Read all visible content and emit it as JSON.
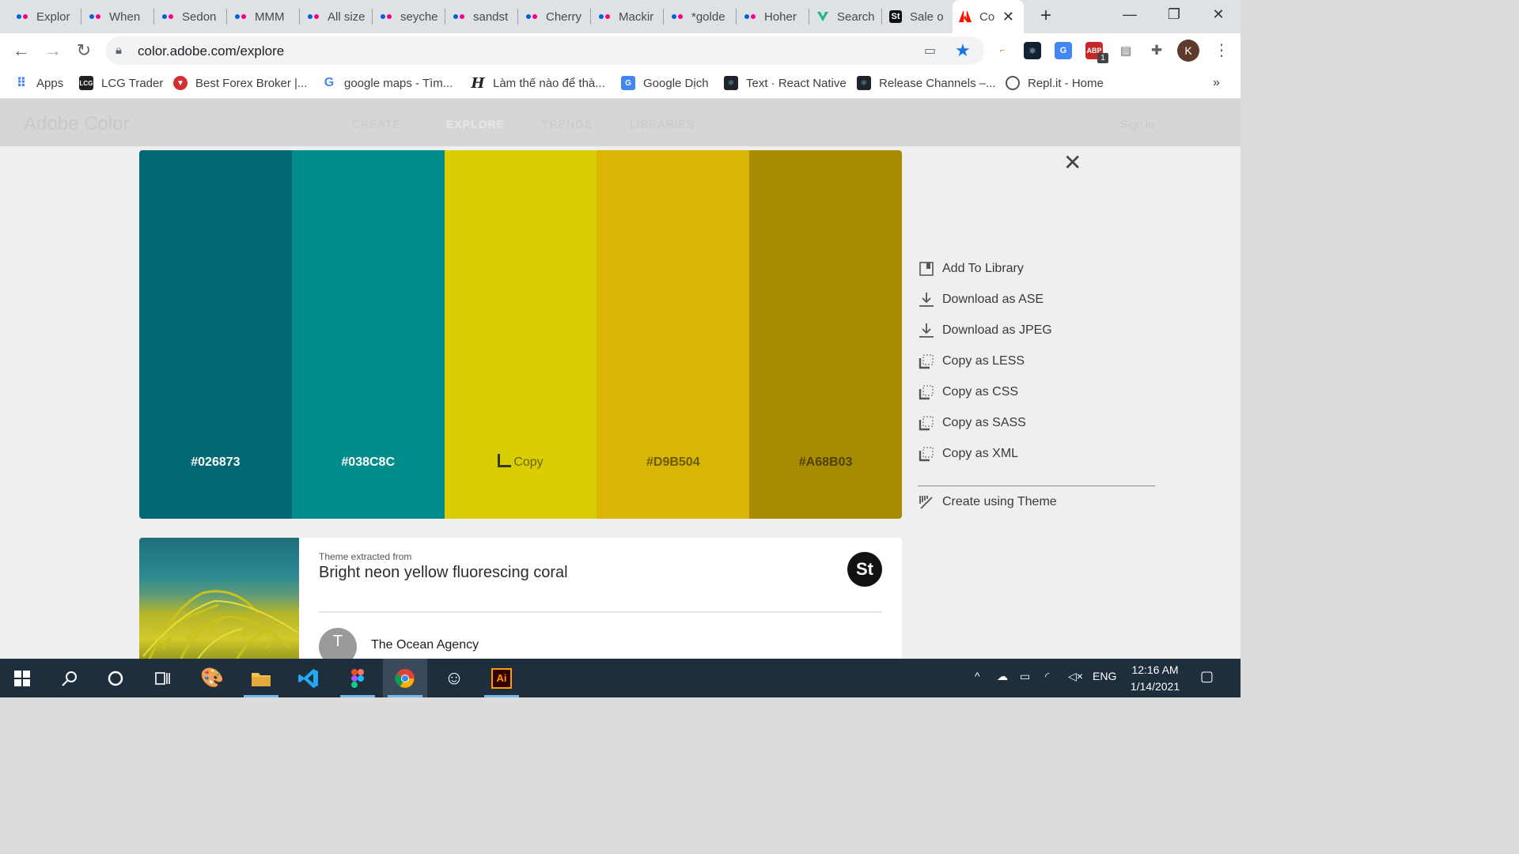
{
  "tabs": [
    {
      "title": "Explor",
      "icon": "flickr-icon"
    },
    {
      "title": "When",
      "icon": "flickr-icon"
    },
    {
      "title": "Sedon",
      "icon": "flickr-icon"
    },
    {
      "title": "MMM",
      "icon": "flickr-icon"
    },
    {
      "title": "All size",
      "icon": "flickr-icon"
    },
    {
      "title": "seyche",
      "icon": "flickr-icon"
    },
    {
      "title": "sandst",
      "icon": "flickr-icon"
    },
    {
      "title": "Cherry",
      "icon": "flickr-icon"
    },
    {
      "title": "Mackir",
      "icon": "flickr-icon"
    },
    {
      "title": "*golde",
      "icon": "flickr-icon"
    },
    {
      "title": "Hoher",
      "icon": "flickr-icon"
    },
    {
      "title": "Search",
      "icon": "vuetify-icon"
    },
    {
      "title": "Sale o",
      "icon": "stock-icon"
    },
    {
      "title": "Co",
      "icon": "adobe-icon",
      "active": true
    }
  ],
  "toolbar": {
    "url": "color.adobe.com/explore",
    "profile_initial": "K",
    "ext_badge": "1"
  },
  "bookmarks": [
    {
      "label": "Apps",
      "icon": "apps-grid-icon"
    },
    {
      "label": "LCG Trader",
      "icon": "lcg-icon"
    },
    {
      "label": "Best Forex Broker |...",
      "icon": "forex-icon"
    },
    {
      "label": "google maps - Tìm...",
      "icon": "google-icon"
    },
    {
      "label": "Làm thế nào để thà...",
      "icon": "script-h-icon"
    },
    {
      "label": "Google Dịch",
      "icon": "google-translate-icon"
    },
    {
      "label": "Text · React Native",
      "icon": "react-icon"
    },
    {
      "label": "Release Channels –...",
      "icon": "react-icon"
    },
    {
      "label": "Repl.it - Home",
      "icon": "replit-icon"
    }
  ],
  "adobe_header": {
    "brand": "Adobe Color",
    "nav": [
      "CREATE",
      "EXPLORE",
      "TRENDS",
      "LIBRARIES"
    ],
    "sign_in": "Sign in"
  },
  "palette": {
    "swatches": [
      {
        "hex": "#026873",
        "label": "#026873",
        "text_color": "#ffffff"
      },
      {
        "hex": "#038C8C",
        "label": "#038C8C",
        "text_color": "#ffffff"
      },
      {
        "hex": "#D9CE04",
        "label": "Copy",
        "text_color": "#6b6400",
        "hover": true
      },
      {
        "hex": "#D9B504",
        "label": "#D9B504",
        "text_color": "#6b5a00"
      },
      {
        "hex": "#A68B03",
        "label": "#A68B03",
        "text_color": "#4f4200"
      }
    ]
  },
  "actions": {
    "items": [
      {
        "label": "Add To Library",
        "icon": "library-icon"
      },
      {
        "label": "Download as ASE",
        "icon": "download-icon"
      },
      {
        "label": "Download as JPEG",
        "icon": "download-icon"
      },
      {
        "label": "Copy as LESS",
        "icon": "copy-icon"
      },
      {
        "label": "Copy as CSS",
        "icon": "copy-icon"
      },
      {
        "label": "Copy as SASS",
        "icon": "copy-icon"
      },
      {
        "label": "Copy as XML",
        "icon": "copy-icon"
      }
    ],
    "create_label": "Create using Theme"
  },
  "theme": {
    "extracted_label": "Theme extracted from",
    "title": "Bright neon yellow fluorescing coral",
    "stock_badge": "St",
    "author_initial": "T",
    "author": "The Ocean Agency"
  },
  "taskbar": {
    "time": "12:16 AM",
    "date": "1/14/2021",
    "lang": "ENG",
    "apps": [
      "start-icon",
      "search-icon",
      "cortana-icon",
      "task-view-icon",
      "paint-icon",
      "file-explorer-icon",
      "vscode-icon",
      "figma-icon",
      "chrome-icon",
      "smiley-app-icon",
      "illustrator-icon"
    ]
  }
}
